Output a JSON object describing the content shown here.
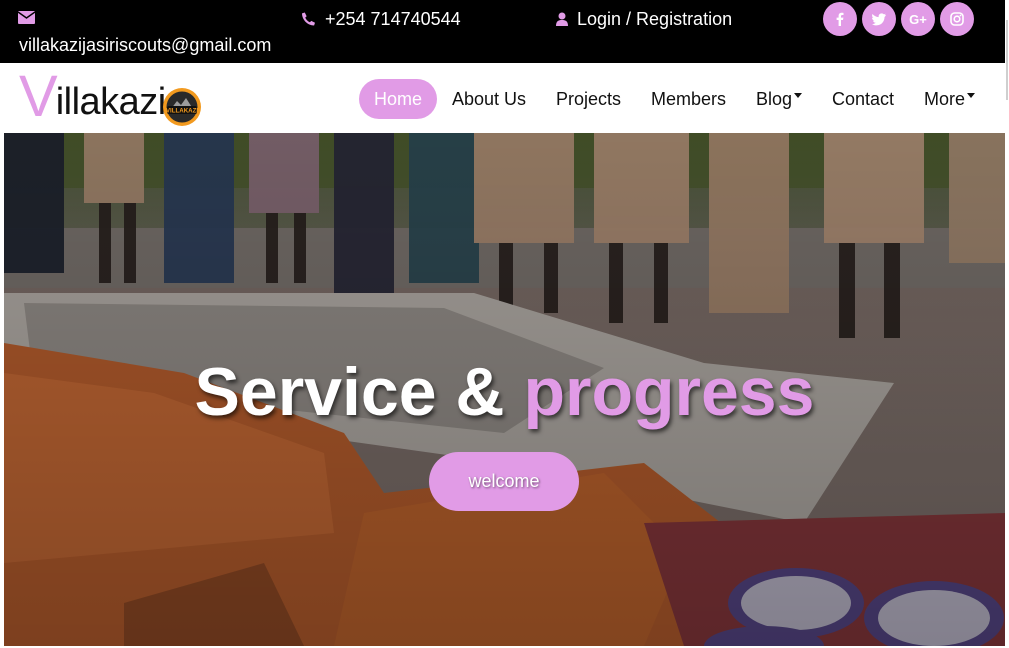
{
  "topbar": {
    "email": "villakazijasiriscouts@gmail.com",
    "phone": "+254 714740544",
    "login": "Login / Registration",
    "social": [
      {
        "label": "f",
        "icon": "facebook-icon"
      },
      {
        "label": "t",
        "icon": "twitter-icon"
      },
      {
        "label": "G+",
        "icon": "google-plus-icon"
      },
      {
        "label": "ig",
        "icon": "instagram-icon"
      }
    ]
  },
  "brand": {
    "first_letter": "V",
    "rest": "illakazi",
    "badge_text": "VILLAKAZI"
  },
  "nav": {
    "home": "Home",
    "about": "About Us",
    "projects": "Projects",
    "members": "Members",
    "blog": "Blog",
    "contact": "Contact",
    "more": "More"
  },
  "hero": {
    "title_main": "Service & ",
    "title_accent": "progress",
    "button": "welcome"
  },
  "colors": {
    "accent": "#e19be6",
    "topbar_bg": "#000000"
  }
}
